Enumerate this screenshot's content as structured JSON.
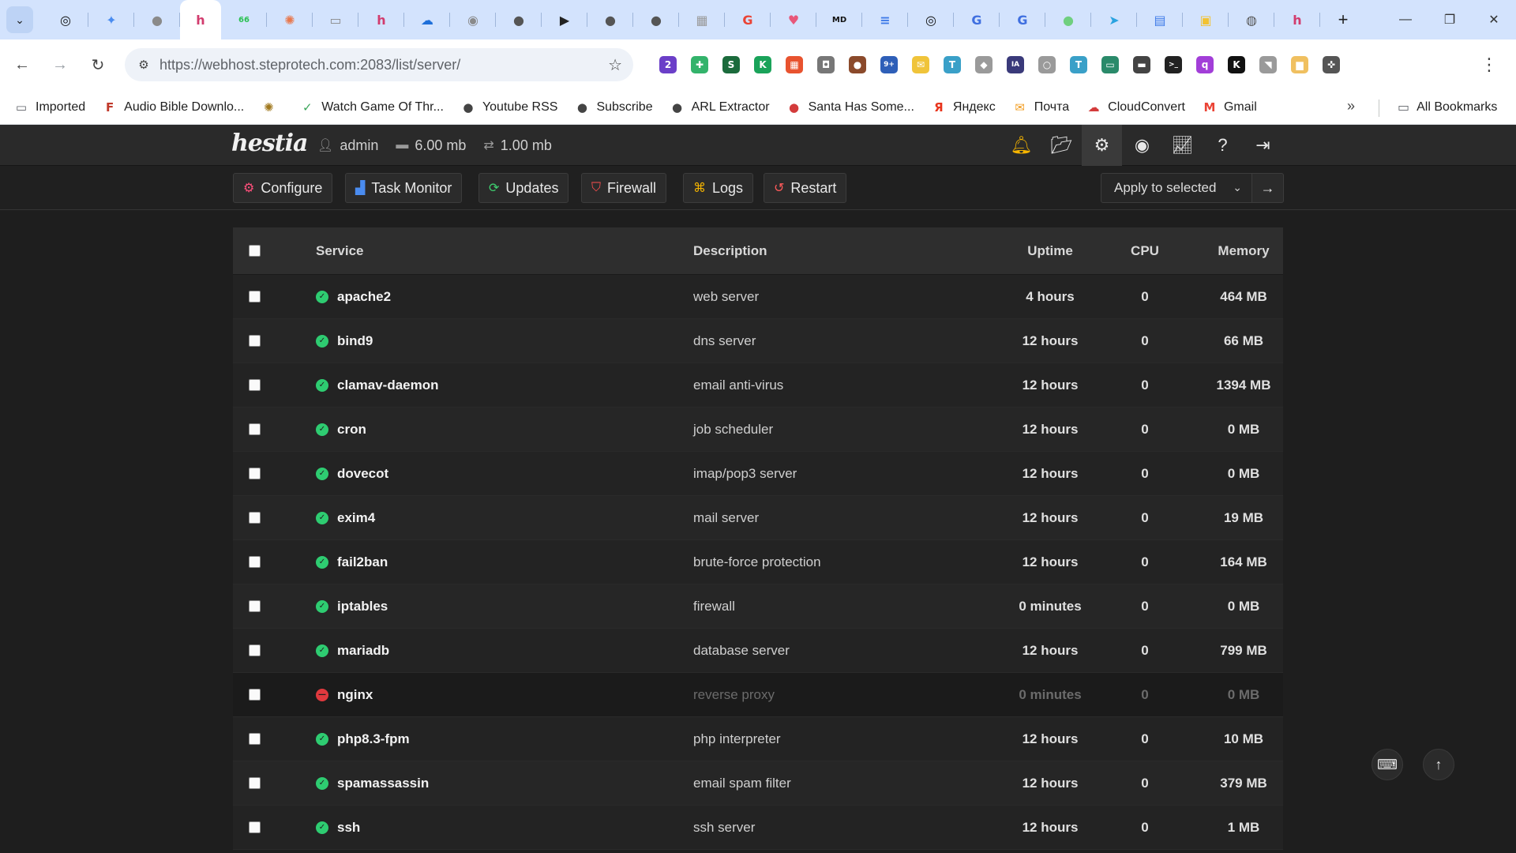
{
  "browser": {
    "tabs": [
      {
        "icon": "openai-icon",
        "glyph": "◎",
        "color": "#111111"
      },
      {
        "icon": "sparkle-icon",
        "glyph": "✦",
        "color": "#4a8cf0"
      },
      {
        "icon": "globe-icon",
        "glyph": "●",
        "color": "#8a8a8a"
      },
      {
        "icon": "hestia-icon",
        "glyph": "h",
        "color": "#d23c6e",
        "active": true
      },
      {
        "icon": "chat-icon",
        "glyph": "66",
        "color": "#2ac152"
      },
      {
        "icon": "asterisk-icon",
        "glyph": "✺",
        "color": "#e8774c"
      },
      {
        "icon": "monitor-icon",
        "glyph": "▭",
        "color": "#8a8a8a"
      },
      {
        "icon": "hestia-icon",
        "glyph": "h",
        "color": "#d23c6e"
      },
      {
        "icon": "cloud-icon",
        "glyph": "☁",
        "color": "#1e6fd9"
      },
      {
        "icon": "record-icon",
        "glyph": "◉",
        "color": "#8a8a8a"
      },
      {
        "icon": "globe-icon",
        "glyph": "●",
        "color": "#555555"
      },
      {
        "icon": "play-icon",
        "glyph": "▶",
        "color": "#222222"
      },
      {
        "icon": "globe-icon",
        "glyph": "●",
        "color": "#555555"
      },
      {
        "icon": "globe-icon",
        "glyph": "●",
        "color": "#555555"
      },
      {
        "icon": "image-icon",
        "glyph": "▦",
        "color": "#9a9a9a"
      },
      {
        "icon": "google-icon",
        "glyph": "G",
        "color": "#ea4335"
      },
      {
        "icon": "heart-icon",
        "glyph": "♥",
        "color": "#e8577a"
      },
      {
        "icon": "markdown-icon",
        "glyph": "MD",
        "color": "#111111"
      },
      {
        "icon": "docs-icon",
        "glyph": "≡",
        "color": "#3f7be8"
      },
      {
        "icon": "openai-icon",
        "glyph": "◎",
        "color": "#111111"
      },
      {
        "icon": "g-icon",
        "glyph": "G",
        "color": "#3f6fe0"
      },
      {
        "icon": "g-icon",
        "glyph": "G",
        "color": "#3f6fe0"
      },
      {
        "icon": "dot-icon",
        "glyph": "●",
        "color": "#6fcf7f"
      },
      {
        "icon": "telegram-icon",
        "glyph": "➤",
        "color": "#2aa3e0"
      },
      {
        "icon": "file-icon",
        "glyph": "▤",
        "color": "#3f7be8"
      },
      {
        "icon": "note-icon",
        "glyph": "▣",
        "color": "#f2c232"
      },
      {
        "icon": "chrome-icon",
        "glyph": "◍",
        "color": "#555555"
      },
      {
        "icon": "hestia-icon",
        "glyph": "h",
        "color": "#d23c6e"
      }
    ],
    "new_tab": "+",
    "url_host": "https://webhost.steprotech.com",
    "url_path": ":2083/list/server/",
    "extensions": [
      {
        "icon": "extension-badge-icon",
        "glyph": "2",
        "color": "#6b3fc8"
      },
      {
        "icon": "leaf-icon",
        "glyph": "✚",
        "color": "#33b36b"
      },
      {
        "icon": "s-icon",
        "glyph": "S",
        "color": "#1b6b3c"
      },
      {
        "icon": "k-icon",
        "glyph": "K",
        "color": "#1aa35a"
      },
      {
        "icon": "grid-icon",
        "glyph": "▦",
        "color": "#e8532f"
      },
      {
        "icon": "camera-icon",
        "glyph": "◘",
        "color": "#777777"
      },
      {
        "icon": "cookie-icon",
        "glyph": "●",
        "color": "#8b4a2b"
      },
      {
        "icon": "badge-icon",
        "glyph": "9+",
        "color": "#2e5fb8"
      },
      {
        "icon": "mail-icon",
        "glyph": "✉",
        "color": "#f0c43a"
      },
      {
        "icon": "translate-icon",
        "glyph": "T",
        "color": "#3aa0c8"
      },
      {
        "icon": "shield-icon",
        "glyph": "◆",
        "color": "#9a9a9a"
      },
      {
        "icon": "ia-icon",
        "glyph": "IA",
        "color": "#3a3a7a"
      },
      {
        "icon": "chat-bubble-icon",
        "glyph": "○",
        "color": "#9a9a9a"
      },
      {
        "icon": "translate-icon",
        "glyph": "T",
        "color": "#3aa0c8"
      },
      {
        "icon": "card-icon",
        "glyph": "▭",
        "color": "#2a8a6a"
      },
      {
        "icon": "screen-icon",
        "glyph": "▬",
        "color": "#444444"
      },
      {
        "icon": "terminal-icon",
        "glyph": ">_",
        "color": "#222222"
      },
      {
        "icon": "q-icon",
        "glyph": "q",
        "color": "#a23ed8"
      },
      {
        "icon": "k-dark-icon",
        "glyph": "K",
        "color": "#111111"
      },
      {
        "icon": "rss-icon",
        "glyph": "◥",
        "color": "#9a9a9a"
      },
      {
        "icon": "folder-cloud-icon",
        "glyph": "▆",
        "color": "#f0c060"
      },
      {
        "icon": "puzzle-icon",
        "glyph": "✜",
        "color": "#555555"
      }
    ],
    "bookmarks": [
      {
        "label": "Imported",
        "icon": "folder-icon",
        "glyph": "▭",
        "color": "#5f6368"
      },
      {
        "label": "Audio Bible Downlo...",
        "icon": "f-icon",
        "glyph": "F",
        "color": "#c0392b"
      },
      {
        "label": "",
        "icon": "sunflower-icon",
        "glyph": "✺",
        "color": "#a0781e"
      },
      {
        "label": "Watch Game Of Thr...",
        "icon": "check-icon",
        "glyph": "✓",
        "color": "#3aa55a"
      },
      {
        "label": "Youtube RSS",
        "icon": "globe-icon",
        "glyph": "●",
        "color": "#444444"
      },
      {
        "label": "Subscribe",
        "icon": "globe-icon",
        "glyph": "●",
        "color": "#444444"
      },
      {
        "label": "ARL Extractor",
        "icon": "globe-icon",
        "glyph": "●",
        "color": "#444444"
      },
      {
        "label": "Santa Has Some...",
        "icon": "santa-icon",
        "glyph": "●",
        "color": "#d33b3b"
      },
      {
        "label": "Яндекс",
        "icon": "yandex-icon",
        "glyph": "Я",
        "color": "#e8341c"
      },
      {
        "label": "Почта",
        "icon": "envelope-icon",
        "glyph": "✉",
        "color": "#f29c1f"
      },
      {
        "label": "CloudConvert",
        "icon": "cloud-icon",
        "glyph": "☁",
        "color": "#d33b3b"
      },
      {
        "label": "Gmail",
        "icon": "gmail-icon",
        "glyph": "M",
        "color": "#ea4335"
      }
    ],
    "more": "»",
    "all_bookmarks": "All Bookmarks"
  },
  "header": {
    "logo": "hestia",
    "user": "admin",
    "disk": "6.00 mb",
    "bandwidth": "1.00 mb"
  },
  "actions": {
    "configure": "Configure",
    "task_monitor": "Task Monitor",
    "updates": "Updates",
    "firewall": "Firewall",
    "logs": "Logs",
    "restart": "Restart",
    "apply_selected": "Apply to selected"
  },
  "table": {
    "columns": {
      "service": "Service",
      "description": "Description",
      "uptime": "Uptime",
      "cpu": "CPU",
      "memory": "Memory"
    },
    "rows": [
      {
        "name": "apache2",
        "description": "web server",
        "uptime": "4 hours",
        "cpu": "0",
        "memory": "464 MB",
        "running": true
      },
      {
        "name": "bind9",
        "description": "dns server",
        "uptime": "12 hours",
        "cpu": "0",
        "memory": "66 MB",
        "running": true
      },
      {
        "name": "clamav-daemon",
        "description": "email anti-virus",
        "uptime": "12 hours",
        "cpu": "0",
        "memory": "1394 MB",
        "running": true
      },
      {
        "name": "cron",
        "description": "job scheduler",
        "uptime": "12 hours",
        "cpu": "0",
        "memory": "0 MB",
        "running": true
      },
      {
        "name": "dovecot",
        "description": "imap/pop3 server",
        "uptime": "12 hours",
        "cpu": "0",
        "memory": "0 MB",
        "running": true
      },
      {
        "name": "exim4",
        "description": "mail server",
        "uptime": "12 hours",
        "cpu": "0",
        "memory": "19 MB",
        "running": true
      },
      {
        "name": "fail2ban",
        "description": "brute-force protection",
        "uptime": "12 hours",
        "cpu": "0",
        "memory": "164 MB",
        "running": true
      },
      {
        "name": "iptables",
        "description": "firewall",
        "uptime": "0 minutes",
        "cpu": "0",
        "memory": "0 MB",
        "running": true
      },
      {
        "name": "mariadb",
        "description": "database server",
        "uptime": "12 hours",
        "cpu": "0",
        "memory": "799 MB",
        "running": true
      },
      {
        "name": "nginx",
        "description": "reverse proxy",
        "uptime": "0 minutes",
        "cpu": "0",
        "memory": "0 MB",
        "running": false
      },
      {
        "name": "php8.3-fpm",
        "description": "php interpreter",
        "uptime": "12 hours",
        "cpu": "0",
        "memory": "10 MB",
        "running": true
      },
      {
        "name": "spamassassin",
        "description": "email spam filter",
        "uptime": "12 hours",
        "cpu": "0",
        "memory": "379 MB",
        "running": true
      },
      {
        "name": "ssh",
        "description": "ssh server",
        "uptime": "12 hours",
        "cpu": "0",
        "memory": "1 MB",
        "running": true
      }
    ]
  },
  "colors": {
    "running": "#2ecc71",
    "stopped": "#e0393e",
    "configure_icon": "#ff4f7b",
    "task_icon": "#4a8cf0",
    "updates_icon": "#3fcf70",
    "firewall_icon": "#ff4f4f",
    "logs_icon": "#f5b400",
    "restart_icon": "#ff5a5a"
  }
}
